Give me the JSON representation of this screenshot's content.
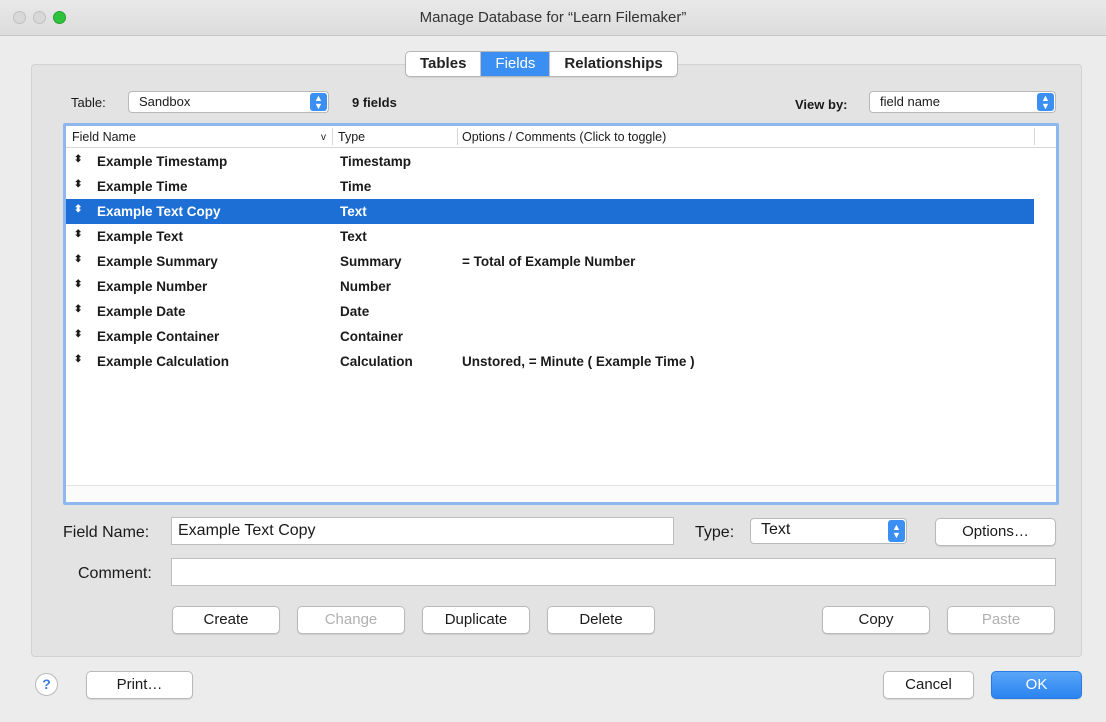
{
  "window": {
    "title": "Manage Database for “Learn Filemaker”"
  },
  "tabs": [
    {
      "label": "Tables",
      "active": false
    },
    {
      "label": "Fields",
      "active": true
    },
    {
      "label": "Relationships",
      "active": false
    }
  ],
  "table_selector": {
    "label": "Table:",
    "value": "Sandbox",
    "count": "9 fields"
  },
  "view_by": {
    "label": "View by:",
    "value": "field name"
  },
  "list": {
    "columns": [
      "Field Name",
      "Type",
      "Options / Comments   (Click to toggle)"
    ],
    "sort_indicator": "v",
    "rows": [
      {
        "name": "Example Timestamp",
        "type": "Timestamp",
        "options": ""
      },
      {
        "name": "Example Time",
        "type": "Time",
        "options": ""
      },
      {
        "name": "Example Text Copy",
        "type": "Text",
        "options": "",
        "selected": true
      },
      {
        "name": "Example Text",
        "type": "Text",
        "options": ""
      },
      {
        "name": "Example Summary",
        "type": "Summary",
        "options": "= Total of Example Number"
      },
      {
        "name": "Example Number",
        "type": "Number",
        "options": ""
      },
      {
        "name": "Example Date",
        "type": "Date",
        "options": ""
      },
      {
        "name": "Example Container",
        "type": "Container",
        "options": ""
      },
      {
        "name": "Example Calculation",
        "type": "Calculation",
        "options": "Unstored, = Minute ( Example Time )"
      }
    ]
  },
  "editor": {
    "field_name_label": "Field Name:",
    "field_name_value": "Example Text Copy",
    "type_label": "Type:",
    "type_value": "Text",
    "options_button": "Options…",
    "comment_label": "Comment:",
    "comment_value": ""
  },
  "actions": {
    "create": "Create",
    "change": "Change",
    "duplicate": "Duplicate",
    "delete": "Delete",
    "copy": "Copy",
    "paste": "Paste"
  },
  "footer": {
    "help": "?",
    "print": "Print…",
    "cancel": "Cancel",
    "ok": "OK"
  },
  "colors": {
    "accent": "#3b8ff2",
    "selection": "#1d6fd6"
  }
}
